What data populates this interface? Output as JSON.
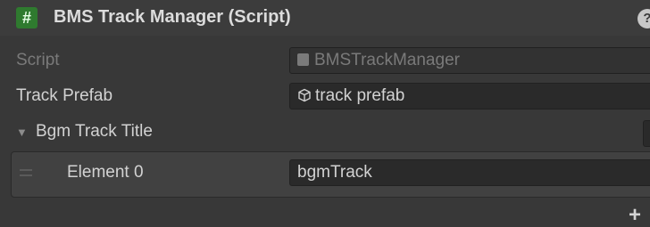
{
  "header": {
    "script_icon": "#",
    "title": "BMS Track Manager (Script)",
    "help_icon": "help-icon"
  },
  "fields": {
    "script": {
      "label": "Script",
      "value": "BMSTrackManager"
    },
    "track_prefab": {
      "label": "Track Prefab",
      "value": "track prefab"
    },
    "bgm_track_title": {
      "label": "Bgm Track Title"
    }
  },
  "list": {
    "elements": [
      {
        "label": "Element 0",
        "value": "bgmTrack"
      }
    ],
    "add_label": "+"
  },
  "colors": {
    "background": "#383838",
    "header": "#3c3c3c",
    "field": "#2a2a2a",
    "script_icon": "#2f7a2f"
  }
}
